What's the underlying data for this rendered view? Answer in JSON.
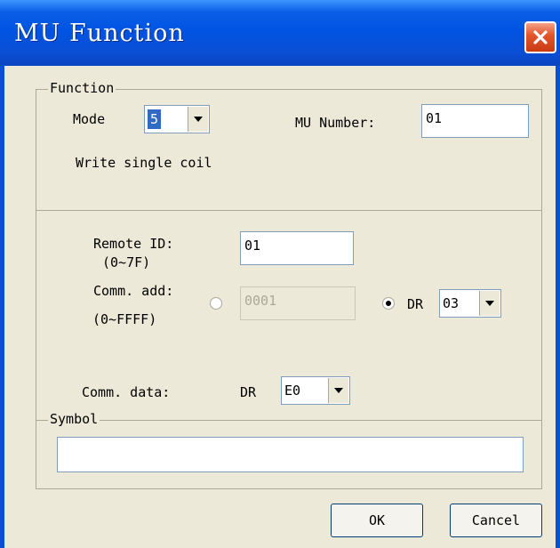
{
  "window": {
    "title": "MU Function"
  },
  "function_group": {
    "label": "Function",
    "mode_label": "Mode",
    "mode_value": "5",
    "mu_number_label": "MU Number:",
    "mu_number_value": "01",
    "description": "Write single coil"
  },
  "remote": {
    "remote_id_label": "Remote ID:",
    "remote_id_range": "(0~7F)",
    "remote_id_value": "01",
    "comm_add_label": "Comm. add:",
    "comm_add_range": "(0~FFFF)",
    "comm_add_value": "0001",
    "dr_label": "DR",
    "dr_value": "03",
    "comm_data_label": "Comm. data:",
    "comm_data_dr_label": "DR",
    "comm_data_value": "E0"
  },
  "symbol": {
    "label": "Symbol",
    "value": ""
  },
  "buttons": {
    "ok": "OK",
    "cancel": "Cancel"
  }
}
